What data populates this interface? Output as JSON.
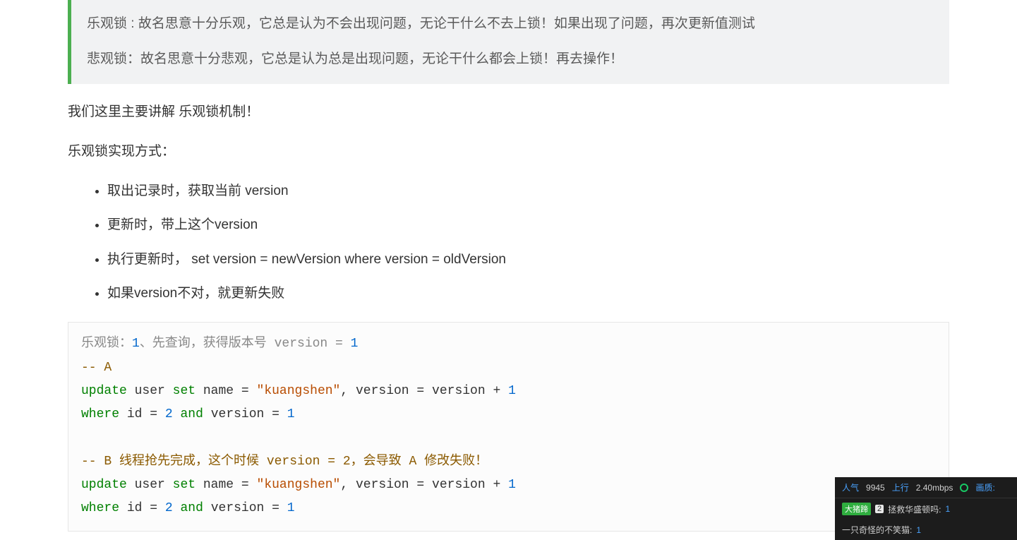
{
  "blockquote": {
    "line1": "乐观锁 : 故名思意十分乐观，它总是认为不会出现问题，无论干什么不去上锁！如果出现了问题，再次更新值测试",
    "line2": "悲观锁：故名思意十分悲观，它总是认为总是出现问题，无论干什么都会上锁！再去操作！"
  },
  "paragraphs": {
    "p1": "我们这里主要讲解 乐观锁机制！",
    "p2": "乐观锁实现方式："
  },
  "bullets": [
    "取出记录时，获取当前 version",
    "更新时，带上这个version",
    "执行更新时， set version = newVersion where version = oldVersion",
    "如果version不对，就更新失败"
  ],
  "code": {
    "intro_prefix": "乐观锁：",
    "intro_num": "1",
    "intro_suffix": "、先查询，获得版本号 version = ",
    "intro_val": "1",
    "cmt_a": "-- A",
    "kw_update": "update",
    "kw_set": "set",
    "kw_where": "where",
    "kw_and": "and",
    "tbl": "user",
    "col_name": "name",
    "eq": "=",
    "str_val": "\"kuangshen\"",
    "comma": ",",
    "col_version": "version",
    "plus": "+",
    "one": "1",
    "col_id": "id",
    "two": "2",
    "cmt_b_prefix": "-- B",
    "cmt_b_mid1": " 线程抢先完成，这个时候 ",
    "cmt_b_ver": "version = 2",
    "cmt_b_mid2": "，会导致 ",
    "cmt_b_a": "A",
    "cmt_b_tail": " 修改失败！"
  },
  "overlay": {
    "stats": {
      "pop_label": "人气",
      "pop_value": "9945",
      "up_label": "上行",
      "up_value": "2.40mbps",
      "qual_label": "画质:"
    },
    "chat": [
      {
        "tag": "大猪蹄",
        "badge": "2",
        "name": "拯救华盛顿吗",
        "msg": "1"
      },
      {
        "tag": "",
        "badge": "",
        "name": "一只奇怪的不笑猫",
        "msg": "1"
      }
    ]
  }
}
